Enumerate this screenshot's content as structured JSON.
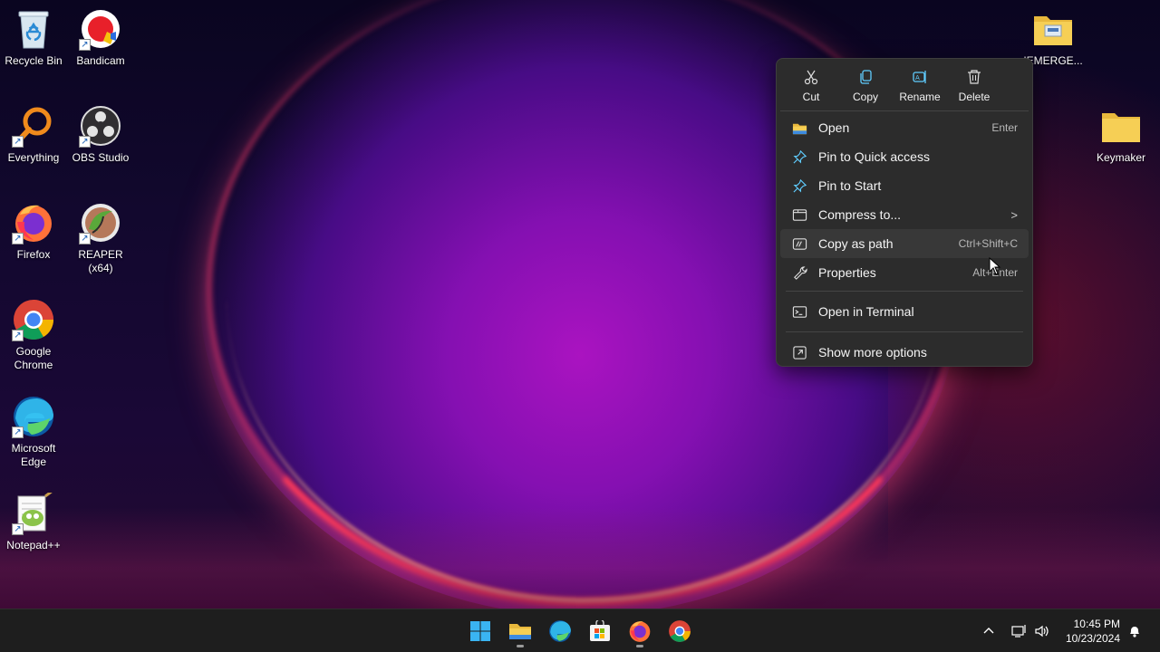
{
  "desktop": {
    "icons": [
      {
        "label": "Recycle Bin"
      },
      {
        "label": "Bandicam"
      },
      {
        "label": "Everything"
      },
      {
        "label": "OBS Studio"
      },
      {
        "label": "Firefox"
      },
      {
        "label": "REAPER (x64)"
      },
      {
        "label": "Google Chrome"
      },
      {
        "label": "Microsoft Edge"
      },
      {
        "label": "Notepad++"
      },
      {
        "label": "!EMERGE..."
      },
      {
        "label": "Keymaker"
      }
    ]
  },
  "context_menu": {
    "top_actions": [
      {
        "label": "Cut",
        "icon": "scissors-icon"
      },
      {
        "label": "Copy",
        "icon": "copy-icon"
      },
      {
        "label": "Rename",
        "icon": "rename-icon"
      },
      {
        "label": "Delete",
        "icon": "trash-icon"
      }
    ],
    "items": [
      {
        "label": "Open",
        "shortcut": "Enter",
        "icon": "folder-icon"
      },
      {
        "label": "Pin to Quick access",
        "shortcut": "",
        "icon": "pin-icon"
      },
      {
        "label": "Pin to Start",
        "shortcut": "",
        "icon": "pin-icon"
      },
      {
        "label": "Compress to...",
        "shortcut": "",
        "icon": "archive-icon",
        "submenu": ">"
      },
      {
        "label": "Copy as path",
        "shortcut": "Ctrl+Shift+C",
        "icon": "path-icon",
        "hovered": true
      },
      {
        "label": "Properties",
        "shortcut": "Alt+Enter",
        "icon": "wrench-icon"
      },
      {
        "label": "Open in Terminal",
        "shortcut": "",
        "icon": "terminal-icon"
      },
      {
        "label": "Show more options",
        "shortcut": "",
        "icon": "more-options-icon"
      }
    ]
  },
  "taskbar": {
    "apps": [
      "start",
      "file-explorer",
      "edge",
      "store",
      "firefox",
      "chrome"
    ],
    "clock": {
      "time": "10:45 PM",
      "date": "10/23/2024"
    }
  },
  "colors": {
    "menu_bg": "#2c2c2c",
    "taskbar_bg": "#1e1e1e",
    "accent_blue": "#60cdff"
  }
}
